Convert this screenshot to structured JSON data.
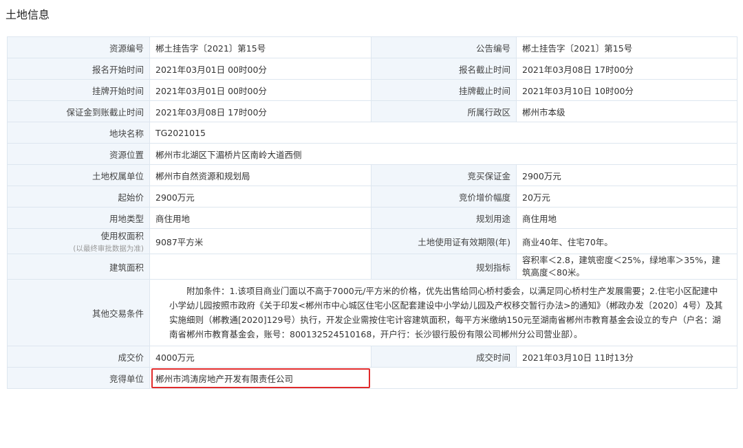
{
  "page": {
    "title": "土地信息"
  },
  "labels": {
    "resource_no": "资源编号",
    "notice_no": "公告编号",
    "reg_start": "报名开始时间",
    "reg_end": "报名截止时间",
    "list_start": "挂牌开始时间",
    "list_end": "挂牌截止时间",
    "deposit_deadline": "保证金到账截止时间",
    "district": "所属行政区",
    "plot_name": "地块名称",
    "location": "资源位置",
    "owner": "土地权属单位",
    "bid_deposit": "竞买保证金",
    "start_price": "起始价",
    "increment": "竞价增价幅度",
    "land_type": "用地类型",
    "plan_use": "规划用途",
    "area": "使用权面积",
    "area_note": "(以最终审批数据为准)",
    "term": "土地使用证有效期限(年)",
    "building_area": "建筑面积",
    "plan_index": "规划指标",
    "other": "其他交易条件",
    "deal_price": "成交价",
    "deal_time": "成交时间",
    "winner": "竞得单位"
  },
  "values": {
    "resource_no": "郴土挂告字〔2021〕第15号",
    "notice_no": "郴土挂告字〔2021〕第15号",
    "reg_start": "2021年03月01日 00时00分",
    "reg_end": "2021年03月08日 17时00分",
    "list_start": "2021年03月01日 00时00分",
    "list_end": "2021年03月10日 10时00分",
    "deposit_deadline": "2021年03月08日 17时00分",
    "district": "郴州市本级",
    "plot_name": "TG2021015",
    "location": "郴州市北湖区下湄桥片区南岭大道西侧",
    "owner": "郴州市自然资源和规划局",
    "bid_deposit": "2900万元",
    "start_price": "2900万元",
    "increment": "20万元",
    "land_type": "商住用地",
    "plan_use": "商住用地",
    "area": "9087平方米",
    "term": "商业40年、住宅70年。",
    "building_area": "",
    "plan_index": "容积率＜2.8，建筑密度＜25%，绿地率＞35%，建筑高度＜80米。",
    "other": "　　附加条件：1.该项目商业门面以不高于7000元/平方米的价格，优先出售给同心桥村委会，以满足同心桥村生产发展需要；2.住宅小区配建中小学幼儿园按照市政府《关于印发<郴州市中心城区住宅小区配套建设中小学幼儿园及产权移交暂行办法>的通知》（郴政办发〔2020〕4号）及其实施细则（郴教通[2020]129号）执行，开发企业需按住宅计容建筑面积，每平方米缴纳150元至湖南省郴州市教育基金会设立的专户（户名：湖南省郴州市教育基金会，账号：800132524510168，开户行：长沙银行股份有限公司郴州分公司营业部）。",
    "deal_price": "4000万元",
    "deal_time": "2021年03月10日 11时13分",
    "winner": "郴州市鸿涛房地产开发有限责任公司"
  },
  "highlight_color": "#e12a2a"
}
